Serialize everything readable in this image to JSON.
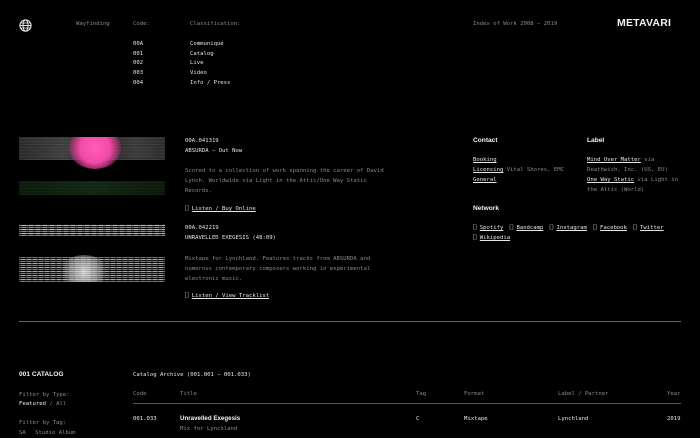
{
  "header": {
    "nav_label": "Wayfinding",
    "code_label": "Code:",
    "classification_label": "Classification:",
    "index_label": "Index of Work 2008 – 2019",
    "logo": "METAVARI",
    "codes": [
      "00A",
      "001",
      "002",
      "003",
      "004"
    ],
    "classifications": [
      "Communiqué",
      "Catalog",
      "Live",
      "Video",
      "Info / Press"
    ]
  },
  "entries": [
    {
      "code": "00A.041319",
      "title": "ABSURDA — Out Now",
      "description": "Scored to a collection of work spanning the career of David Lynch. Worldwide via Light in the Attic/One Way Static Records.",
      "link_icon": "⎕",
      "link": "Listen / Buy Online"
    },
    {
      "code": "00A.042219",
      "title": "UNRAVELLED EXEGESIS (48:09)",
      "description": "Mixtape for Lynchland. Features tracks from ABSURDA and numerous contemporary composers working in experimental electronic music.",
      "link_icon": "⎕",
      "link": "Listen / View Tracklist"
    }
  ],
  "contact": {
    "heading": "Contact",
    "items": [
      {
        "label": "Booking",
        "text": ""
      },
      {
        "label": "Licensing",
        "text": "Vital Shores, EMC"
      },
      {
        "label": "General",
        "text": ""
      }
    ]
  },
  "label_block": {
    "heading": "Label",
    "line1_link": "Mind Over Matter",
    "line1_text": "via",
    "line2": "Deathwish, Inc. (US, EU)",
    "line3_link": "One Way Static",
    "line3_text": "via Light in",
    "line4": "the Attic (World)"
  },
  "network": {
    "heading": "Network",
    "icon": "⎕",
    "links": [
      "Spotify",
      "Bandcamp",
      "Instagram",
      "Facebook",
      "Twitter",
      "Wikipedia"
    ]
  },
  "catalog": {
    "section_title": "001 CATALOG",
    "archive_label": "Catalog Archive (001.001 – 001.033)",
    "filter_type_label": "Filter by Type:",
    "filter_type_active": "Featured",
    "filter_type_sep": "/",
    "filter_type_all": "All",
    "filter_tag_label": "Filter by Tag:",
    "filter_tag_code": "SA",
    "filter_tag_name": "Studio Album",
    "columns": [
      "Code",
      "Title",
      "Tag",
      "Format",
      "Label / Partner",
      "Year"
    ],
    "rows": [
      {
        "code": "001.033",
        "title": "Unravelled Exegesis",
        "subtitle": "Mix for Lynchland",
        "tag": "C",
        "format": "Mixtape",
        "label": "Lynchland",
        "year": "2019"
      }
    ]
  },
  "colors": {
    "background": "#000000",
    "text": "#e6e6e6",
    "muted": "#8a8a8a",
    "accent_pink": "#f04aa8"
  }
}
